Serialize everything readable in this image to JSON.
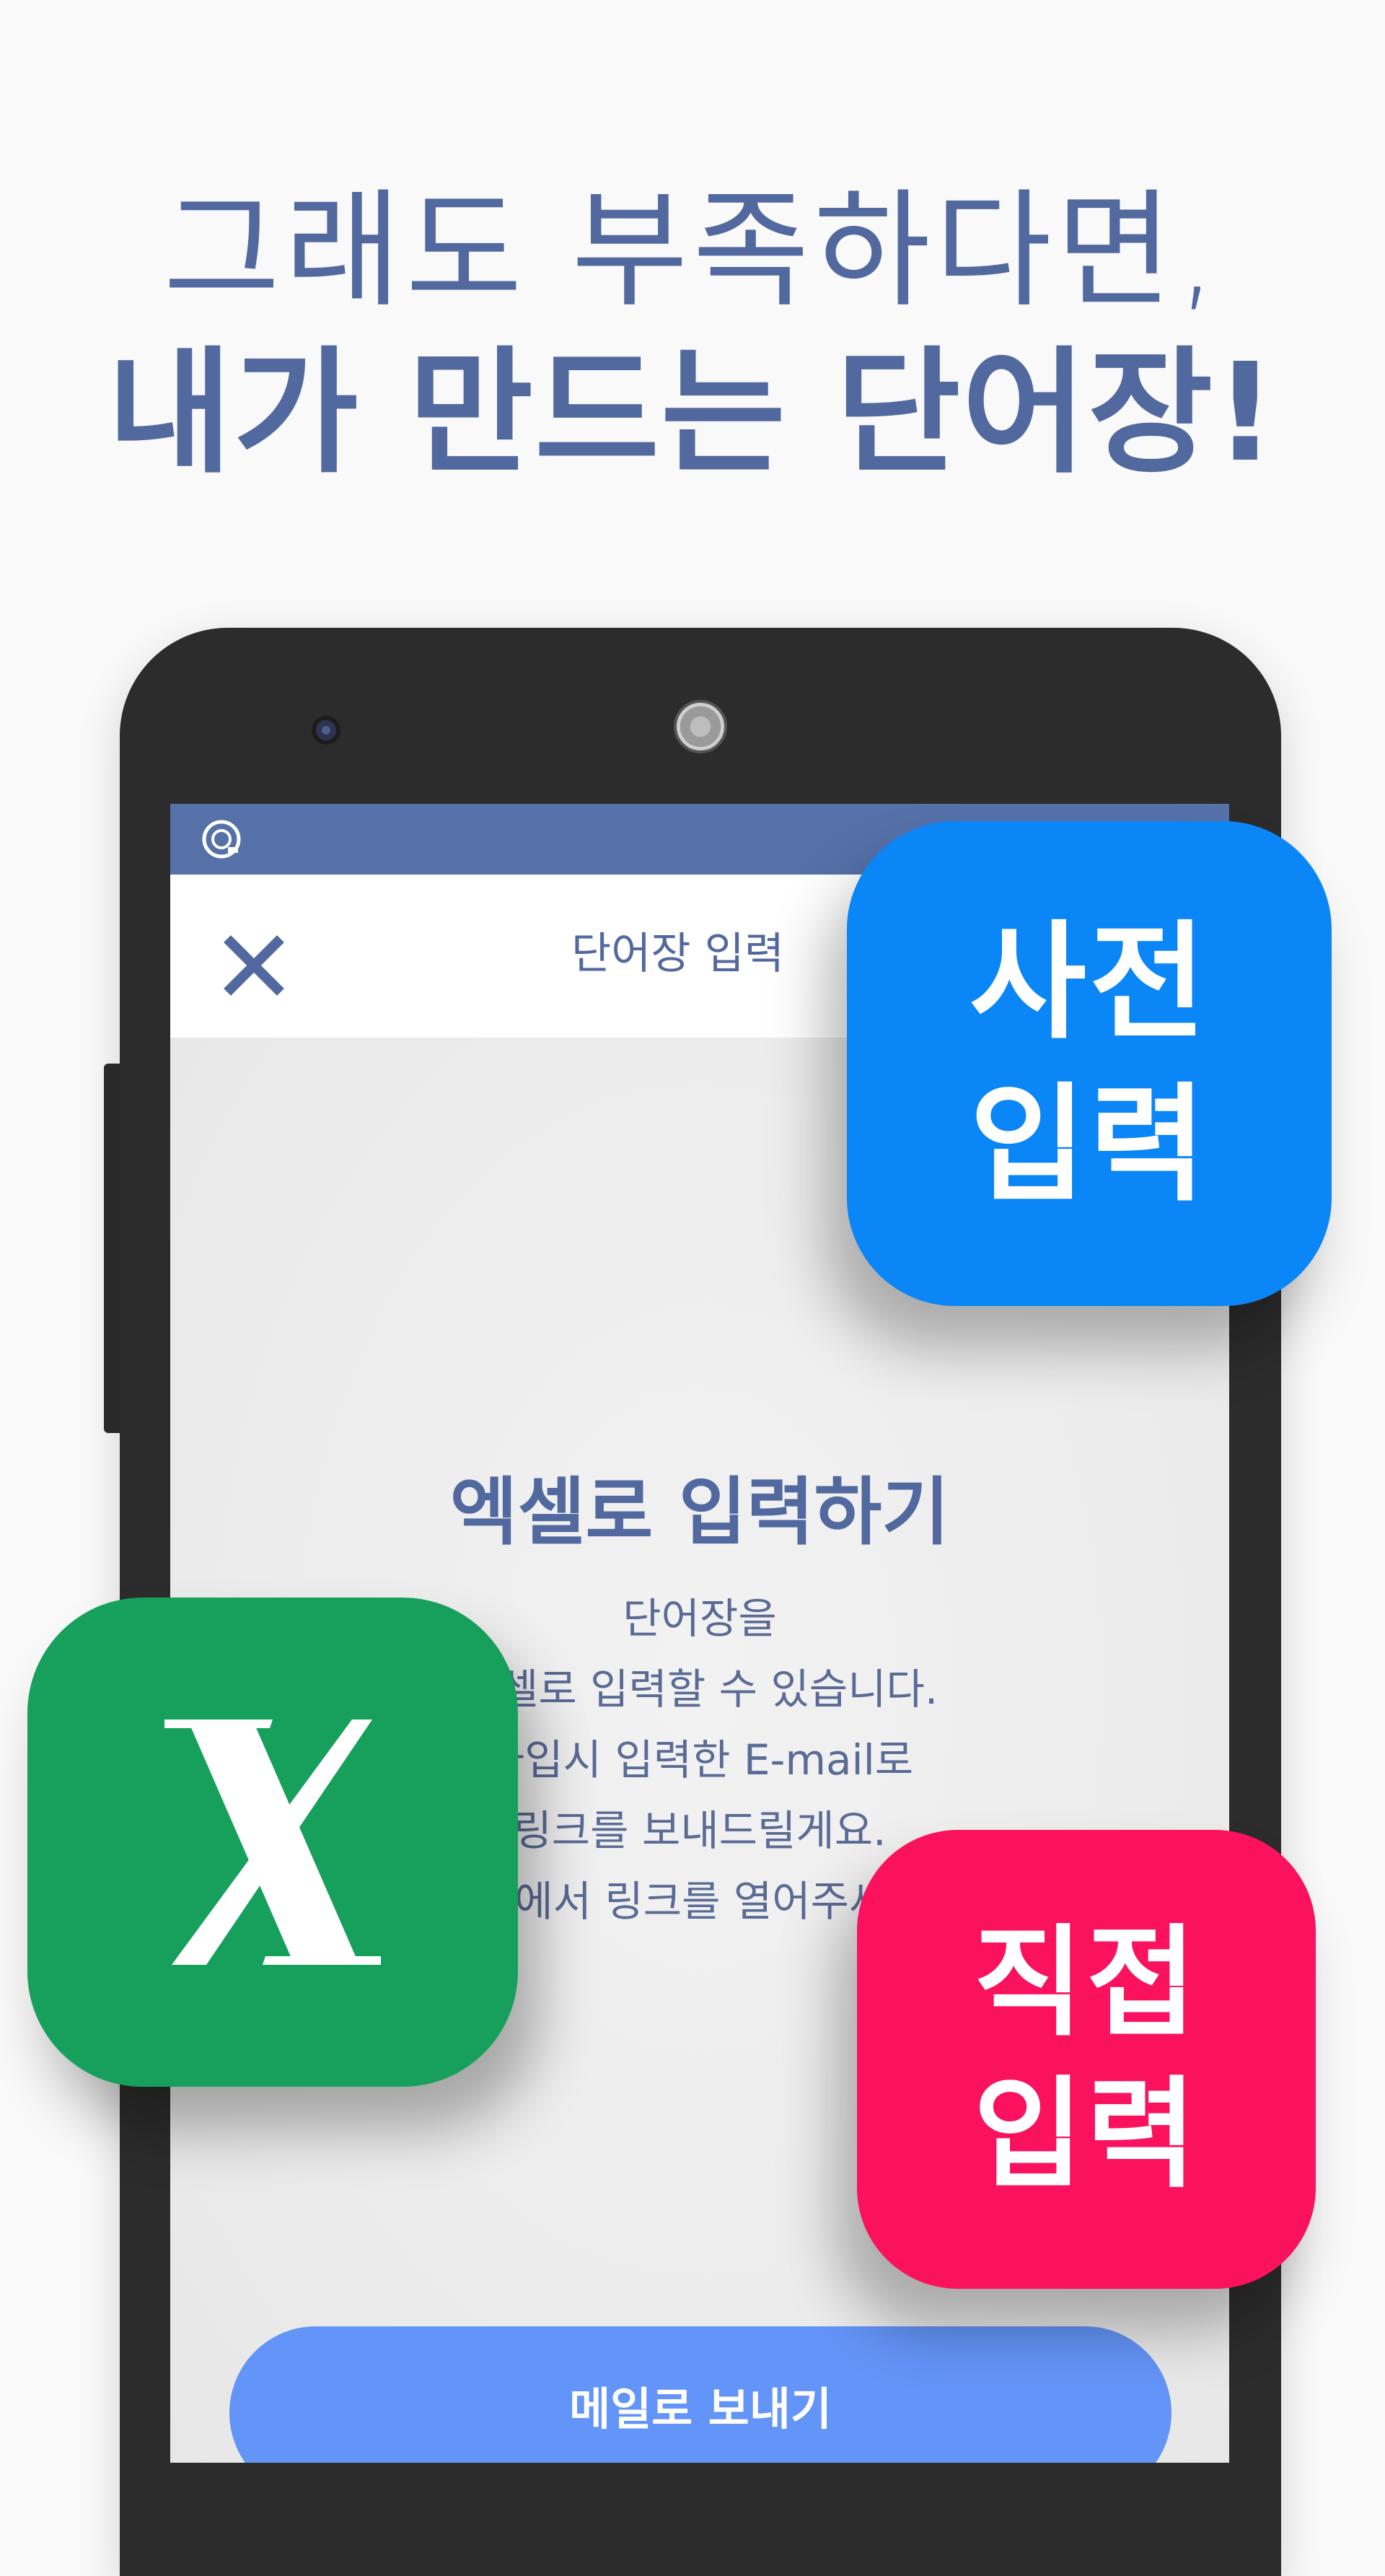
{
  "headline": {
    "line1": "그래도 부족하다면,",
    "line2": "내가 만드는 단어장!"
  },
  "colors": {
    "headline": "#52699f",
    "statusbar": "#5571a8",
    "dictionary_tile": "#0a86f6",
    "excel_tile": "#17a05c",
    "direct_tile": "#fa125f",
    "send_button": "#6394f7"
  },
  "phone": {
    "status_bar": {
      "app_icon": "app-logo-icon",
      "right_text": "⋯"
    },
    "app_bar": {
      "close_icon": "close-icon",
      "title": "단어장 입력"
    },
    "content": {
      "section_title": "엑셀로 입력하기",
      "description_lines": [
        "단어장을",
        "엑셀로 입력할 수 있습니다.",
        "가입시 입력한 E-mail로",
        "링크를 보내드릴게요.",
        "PC에서 링크를 열어주세요."
      ],
      "send_button": "메일로 보내기"
    }
  },
  "tiles": {
    "dictionary": {
      "line1": "사전",
      "line2": "입력"
    },
    "excel": {
      "icon": "excel-x-icon",
      "letter": "X"
    },
    "direct": {
      "line1": "직접",
      "line2": "입력"
    }
  }
}
